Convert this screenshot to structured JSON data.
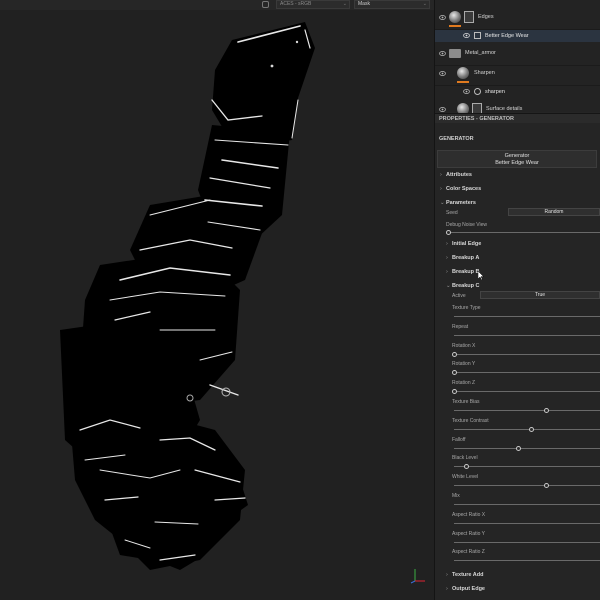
{
  "viewport": {
    "color_space": "ACES - sRGB",
    "channel": "Mask"
  },
  "layers": [
    {
      "name": "Edges",
      "type": "fill",
      "has_mask": true,
      "bar": true
    },
    {
      "name": "Metal_armor",
      "type": "folder",
      "has_mask": false,
      "bar": false
    },
    {
      "name": "Sharpen",
      "type": "fill",
      "has_mask": false,
      "bar": true
    },
    {
      "name": "Surface details",
      "type": "fill",
      "has_mask": true,
      "bar": false
    }
  ],
  "sublayers": [
    {
      "name": "Better Edge Wear",
      "selected": true
    },
    {
      "name": "sharpen",
      "selected": false
    }
  ],
  "properties": {
    "header": "PROPERTIES - GENERATOR",
    "section_label": "GENERATOR",
    "generator_title": "Generator",
    "generator_name": "Better Edge Wear"
  },
  "sections": {
    "attributes": "Attributes",
    "color_spaces": "Color Spaces",
    "parameters": "Parameters",
    "initial_edge": "Initial Edge",
    "breakup_a": "Breakup A",
    "breakup_b": "Breakup B",
    "breakup_c": "Breakup C",
    "texture_add": "Texture Add",
    "output_edge": "Output Edge"
  },
  "params": {
    "seed_label": "Seed",
    "seed_value": "Random",
    "debug_label": "Debug Noise View",
    "debug_value": 0.0,
    "active_label": "Active",
    "active_value": "True"
  },
  "breakup_c_sliders": [
    {
      "label": "Texture Type",
      "value": null
    },
    {
      "label": "Repeat",
      "value": null
    },
    {
      "label": "Rotation X",
      "value": 0.0
    },
    {
      "label": "Rotation Y",
      "value": 0.0
    },
    {
      "label": "Rotation Z",
      "value": 0.0
    },
    {
      "label": "Texture Bias",
      "value": 0.63
    },
    {
      "label": "Texture Contrast",
      "value": 0.53
    },
    {
      "label": "Falloff",
      "value": 0.44
    },
    {
      "label": "Black Level",
      "value": 0.08
    },
    {
      "label": "White Level",
      "value": 0.63
    },
    {
      "label": "Mix",
      "value": null
    },
    {
      "label": "Aspect Ratio X",
      "value": null
    },
    {
      "label": "Aspect Ratio Y",
      "value": null
    },
    {
      "label": "Aspect Ratio Z",
      "value": null
    }
  ],
  "colors": {
    "accent_orange": "#e07a1f",
    "selection": "#2b3440",
    "panel_bg": "#252525",
    "viewport_bg": "#212121"
  }
}
